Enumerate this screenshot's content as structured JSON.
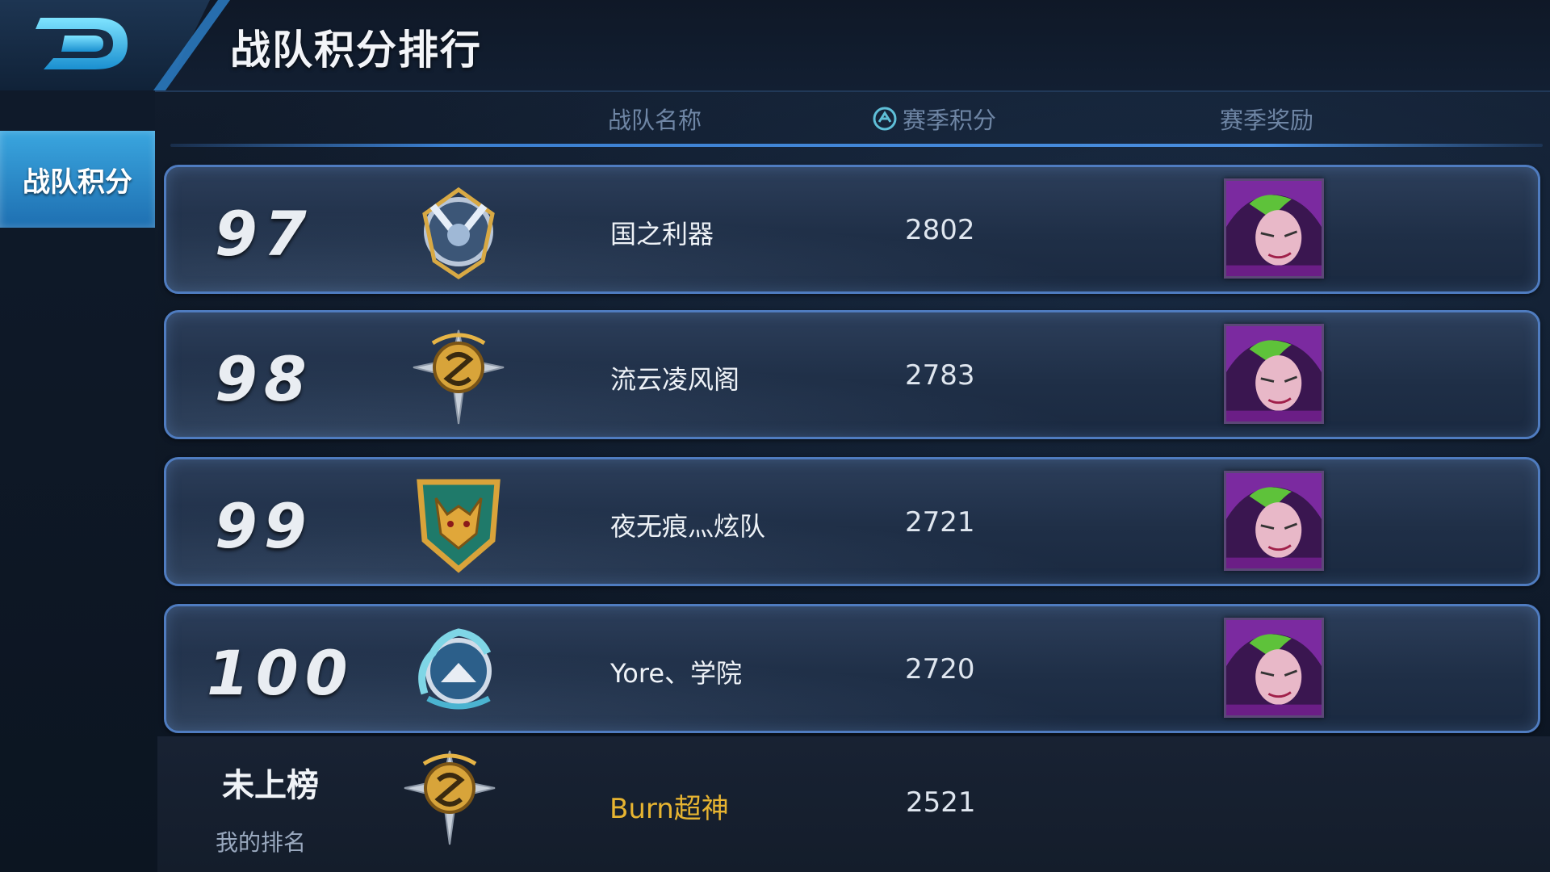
{
  "header": {
    "title": "战队积分排行"
  },
  "sidebar": {
    "tab_label": "战队积分"
  },
  "columns": {
    "team_name": "战队名称",
    "season_score": "赛季积分",
    "season_reward": "赛季奖励"
  },
  "rows": [
    {
      "rank": "97",
      "team": "国之利器",
      "score": "2802",
      "badge_icon": "silver-wing-crest-icon"
    },
    {
      "rank": "98",
      "team": "流云凌风阁",
      "score": "2783",
      "badge_icon": "gold-serpent-crest-icon"
    },
    {
      "rank": "99",
      "team": "夜无痕灬炫队",
      "score": "2721",
      "badge_icon": "gold-wolf-shield-icon"
    },
    {
      "rank": "100",
      "team": "Yore、学院",
      "score": "2720",
      "badge_icon": "blue-dragon-crest-icon"
    }
  ],
  "my_rank": {
    "rank_text": "未上榜",
    "label": "我的排名",
    "team": "Burn超神",
    "score": "2521",
    "badge_icon": "gold-serpent-crest-icon"
  },
  "colors": {
    "accent_blue": "#3aa6df",
    "row_border": "#4f7cc0",
    "my_team_gold": "#e7b431"
  }
}
